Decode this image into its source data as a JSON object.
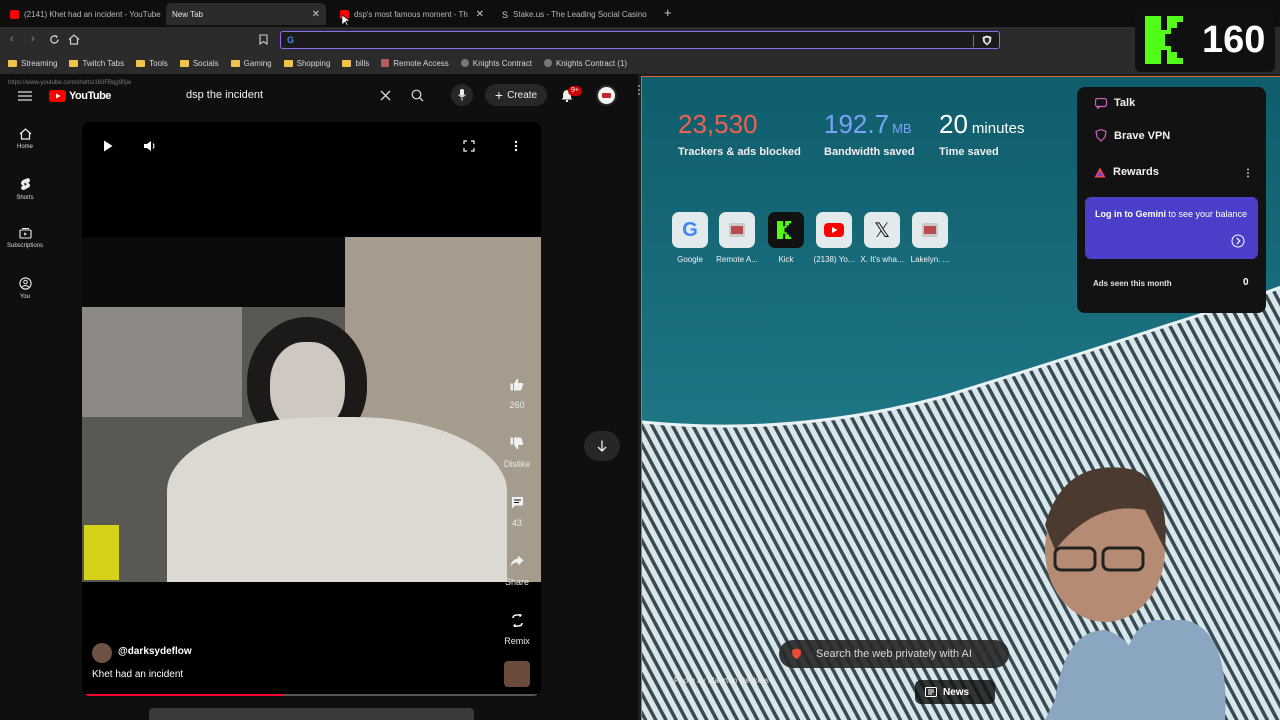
{
  "browser": {
    "tabs": [
      {
        "title": "(2141) Khet had an incident - YouTube",
        "favicon_color": "#ff0000"
      },
      {
        "title": "New Tab",
        "favicon_color": ""
      },
      {
        "title": "dsp's most famous moment - Th",
        "favicon_color": "#ff0000"
      },
      {
        "title": "Stake.us - The Leading Social Casino",
        "favicon_color": "#cfcfcf"
      }
    ],
    "new_tab_button": "+",
    "status_url": "https://www.youtube.com/shorts/163FBqg90jw",
    "address_value": "",
    "bookmarks": [
      {
        "label": "Streaming",
        "type": "folder"
      },
      {
        "label": "Twitch Tabs",
        "type": "folder"
      },
      {
        "label": "Tools",
        "type": "folder"
      },
      {
        "label": "Socials",
        "type": "folder"
      },
      {
        "label": "Gaming",
        "type": "folder"
      },
      {
        "label": "Shopping",
        "type": "folder"
      },
      {
        "label": "bills",
        "type": "folder"
      },
      {
        "label": "Remote Access",
        "type": "page"
      },
      {
        "label": "Knights Contract",
        "type": "page"
      },
      {
        "label": "Knights Contract (1)",
        "type": "page"
      }
    ]
  },
  "kick_overlay": {
    "logo": "K",
    "viewer_count": "160",
    "accent": "#53fc18"
  },
  "youtube": {
    "logo_text": "YouTube",
    "search_value": "dsp the incident",
    "create_label": "Create",
    "notification_badge": "9+",
    "sidebar": [
      {
        "label": "Home",
        "icon": "home-icon"
      },
      {
        "label": "Shorts",
        "icon": "shorts-icon"
      },
      {
        "label": "Subscriptions",
        "icon": "subscriptions-icon"
      },
      {
        "label": "You",
        "icon": "you-icon"
      }
    ],
    "actions": {
      "like_count": "260",
      "dislike_label": "Dislike",
      "comment_count": "43",
      "share_label": "Share",
      "remix_label": "Remix"
    },
    "channel": "@darksydeflow",
    "video_title": "Khet had an incident",
    "progress": 0.44
  },
  "newtab": {
    "stats": [
      {
        "value": "23,530",
        "unit": "",
        "label": "Trackers & ads blocked",
        "color": "#f0614f"
      },
      {
        "value": "192.7",
        "unit": "MB",
        "label": "Bandwidth saved",
        "color": "#7aa3f7"
      },
      {
        "value": "20",
        "unit": "minutes",
        "label": "Time saved",
        "color": "#ffffff"
      }
    ],
    "tiles": [
      {
        "label": "Google"
      },
      {
        "label": "Remote A..."
      },
      {
        "label": "Kick"
      },
      {
        "label": "(2138) Yo..."
      },
      {
        "label": "X. It's wha..."
      },
      {
        "label": "Lakelyn. ..."
      }
    ],
    "widget": {
      "talk": "Talk",
      "vpn": "Brave VPN",
      "rewards": "Rewards",
      "gemini_bold": "Log in to Gemini",
      "gemini_rest": " to see your balance",
      "ads_label": "Ads seen this month",
      "ads_value": "0"
    },
    "ai_search_placeholder": "Search the web privately with AI",
    "photo_credit": "Photo by Maarten Deckers",
    "news_label": "News"
  }
}
